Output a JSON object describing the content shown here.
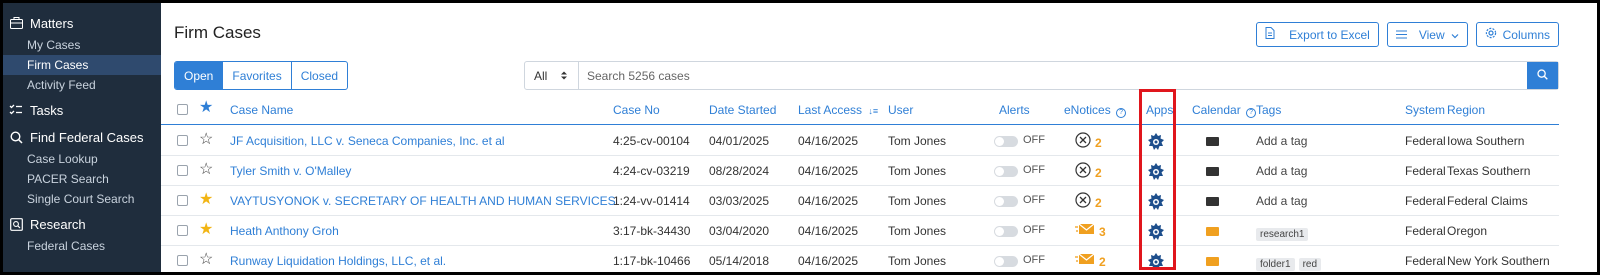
{
  "sidebar": {
    "sections": [
      {
        "label": "Matters",
        "icon": "briefcase-icon",
        "items": [
          {
            "label": "My Cases",
            "active": false
          },
          {
            "label": "Firm Cases",
            "active": true
          },
          {
            "label": "Activity Feed",
            "active": false
          }
        ]
      },
      {
        "label": "Tasks",
        "icon": "tasks-icon",
        "items": []
      },
      {
        "label": "Find Federal Cases",
        "icon": "search-icon",
        "items": [
          {
            "label": "Case Lookup",
            "active": false
          },
          {
            "label": "PACER Search",
            "active": false
          },
          {
            "label": "Single Court Search",
            "active": false
          }
        ]
      },
      {
        "label": "Research",
        "icon": "research-icon",
        "items": [
          {
            "label": "Federal Cases",
            "active": false
          }
        ]
      }
    ]
  },
  "header": {
    "title": "Firm Cases",
    "export_label": "Export to Excel",
    "view_label": "View",
    "columns_label": "Columns"
  },
  "filters": {
    "tabs": [
      "Open",
      "Favorites",
      "Closed"
    ],
    "active_tab": "Open",
    "scope": "All",
    "search_placeholder": "Search 5256 cases"
  },
  "table": {
    "columns": {
      "case_name": "Case Name",
      "case_no": "Case No",
      "date_started": "Date Started",
      "last_access": "Last Access",
      "user": "User",
      "alerts": "Alerts",
      "enotices": "eNotices",
      "apps": "Apps",
      "calendar": "Calendar",
      "tags": "Tags",
      "system": "System",
      "region": "Region"
    },
    "rows": [
      {
        "favorite": false,
        "case_name": "JF Acquisition, LLC v. Seneca Companies, Inc. et al",
        "case_no": "4:25-cv-00104",
        "date_started": "04/01/2025",
        "last_access": "04/16/2025",
        "user": "Tom Jones",
        "alert": "OFF",
        "enotice_type": "cancel",
        "enotice_count": "2",
        "calendar_color": "#333333",
        "tag_text": "Add a tag",
        "tags": [],
        "system": "Federal",
        "region": "Iowa Southern"
      },
      {
        "favorite": false,
        "case_name": "Tyler Smith v. O'Malley",
        "case_no": "4:24-cv-03219",
        "date_started": "08/28/2024",
        "last_access": "04/16/2025",
        "user": "Tom Jones",
        "alert": "OFF",
        "enotice_type": "cancel",
        "enotice_count": "2",
        "calendar_color": "#333333",
        "tag_text": "Add a tag",
        "tags": [],
        "system": "Federal",
        "region": "Texas Southern"
      },
      {
        "favorite": true,
        "case_name": "VAYTUSYONOK v. SECRETARY OF HEALTH AND HUMAN SERVICES",
        "case_no": "1:24-vv-01414",
        "date_started": "03/03/2025",
        "last_access": "04/16/2025",
        "user": "Tom Jones",
        "alert": "OFF",
        "enotice_type": "cancel",
        "enotice_count": "2",
        "calendar_color": "#333333",
        "tag_text": "Add a tag",
        "tags": [],
        "system": "Federal",
        "region": "Federal Claims"
      },
      {
        "favorite": true,
        "case_name": "Heath Anthony Groh",
        "case_no": "3:17-bk-34430",
        "date_started": "03/04/2020",
        "last_access": "04/16/2025",
        "user": "Tom Jones",
        "alert": "OFF",
        "enotice_type": "mail",
        "enotice_count": "3",
        "calendar_color": "#f0a020",
        "tag_text": "",
        "tags": [
          "research1"
        ],
        "system": "Federal",
        "region": "Oregon"
      },
      {
        "favorite": false,
        "case_name": "Runway Liquidation Holdings, LLC, et al.",
        "case_no": "1:17-bk-10466",
        "date_started": "05/14/2018",
        "last_access": "04/16/2025",
        "user": "Tom Jones",
        "alert": "OFF",
        "enotice_type": "mail",
        "enotice_count": "2",
        "calendar_color": "#f0a020",
        "tag_text": "",
        "tags": [
          "folder1",
          "red"
        ],
        "system": "Federal",
        "region": "New York Southern"
      }
    ]
  },
  "colors": {
    "accent": "#2f7fd6",
    "sidebar_bg": "#1f2d3d",
    "highlight": "#e0161d",
    "star": "#f2b514",
    "notice": "#f0a020"
  }
}
